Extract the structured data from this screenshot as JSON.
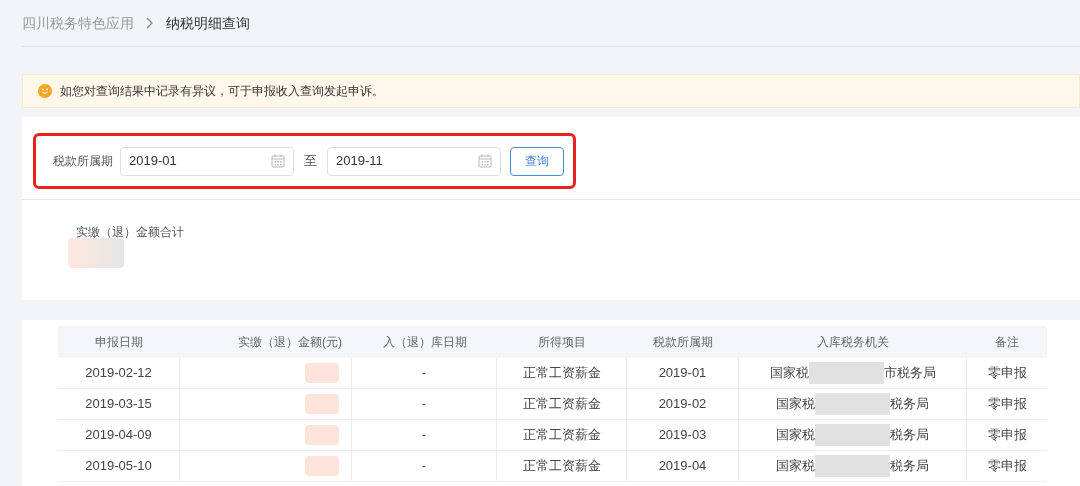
{
  "breadcrumb": [
    "四川税务特色应用",
    "纳税明细查询"
  ],
  "notice": "如您对查询结果中记录有异议，可于申报收入查询发起申诉。",
  "query": {
    "highlighted": true,
    "label": "税款所属期",
    "from": "2019-01",
    "separator": "至",
    "to": "2019-11",
    "button": "查询"
  },
  "summary": {
    "label": "实缴（退）金额合计"
  },
  "table": {
    "columns": [
      "申报日期",
      "实缴（退）金额(元)",
      "入（退）库日期",
      "所得项目",
      "税款所属期",
      "入库税务机关",
      "备注"
    ],
    "rows": [
      {
        "date": "2019-02-12",
        "storage_date": "-",
        "item": "正常工资薪金",
        "period": "2019-01",
        "office_prefix": "国家税",
        "office_suffix": "市税务局",
        "note": "零申报"
      },
      {
        "date": "2019-03-15",
        "storage_date": "-",
        "item": "正常工资薪金",
        "period": "2019-02",
        "office_prefix": "国家税",
        "office_suffix": "税务局",
        "note": "零申报"
      },
      {
        "date": "2019-04-09",
        "storage_date": "-",
        "item": "正常工资薪金",
        "period": "2019-03",
        "office_prefix": "国家税",
        "office_suffix": "税务局",
        "note": "零申报"
      },
      {
        "date": "2019-05-10",
        "storage_date": "-",
        "item": "正常工资薪金",
        "period": "2019-04",
        "office_prefix": "国家税",
        "office_suffix": "税务局",
        "note": "零申报"
      }
    ]
  }
}
